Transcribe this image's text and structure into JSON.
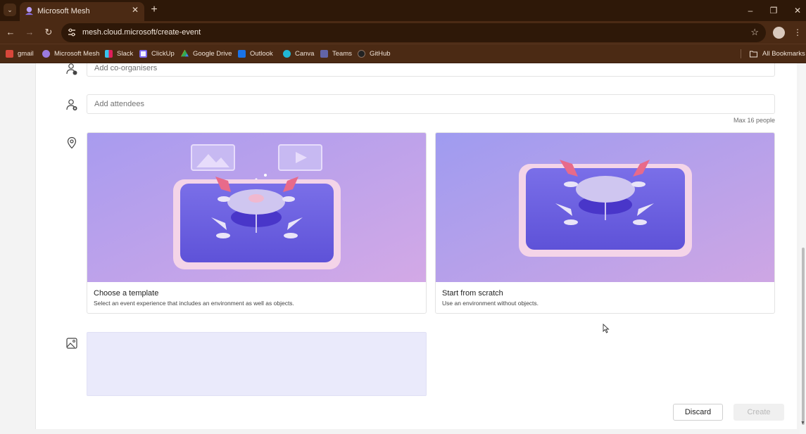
{
  "browser": {
    "tab": {
      "title": "Microsoft Mesh",
      "close_glyph": "✕"
    },
    "new_tab_glyph": "+",
    "window_controls": {
      "minimize": "–",
      "restore": "❐",
      "close": "✕"
    },
    "url": "mesh.cloud.microsoft/create-event",
    "bookmarks": [
      {
        "label": "gmail",
        "icon": "gmail-icon",
        "color": "#d8473a"
      },
      {
        "label": "Microsoft Mesh",
        "icon": "mesh-icon",
        "color": "#9b7be0"
      },
      {
        "label": "Slack",
        "icon": "slack-icon",
        "color": "#36c5f0"
      },
      {
        "label": "ClickUp",
        "icon": "clickup-icon",
        "color": "#7b68ee"
      },
      {
        "label": "Google Drive",
        "icon": "drive-icon",
        "color": "#34a853"
      },
      {
        "label": "Outlook",
        "icon": "outlook-icon",
        "color": "#1a73e8"
      },
      {
        "label": "Canva",
        "icon": "canva-icon",
        "color": "#21b8d6"
      },
      {
        "label": "Teams",
        "icon": "teams-icon",
        "color": "#6264a7"
      },
      {
        "label": "GitHub",
        "icon": "github-icon",
        "color": "#222222"
      }
    ],
    "all_bookmarks": "All Bookmarks"
  },
  "form": {
    "co_organisers_placeholder": "Add co-organisers",
    "attendees_placeholder": "Add attendees",
    "attendees_hint": "Max 16 people",
    "template_card": {
      "title": "Choose a template",
      "description": "Select an event experience that includes an environment as well as objects."
    },
    "scratch_card": {
      "title": "Start from scratch",
      "description": "Use an environment without objects."
    },
    "discard_label": "Discard",
    "create_label": "Create"
  },
  "colors": {
    "chrome_dark": "#2e1808",
    "chrome": "#4b2a14",
    "art_purple": "#6a5ee0",
    "chair_pink": "#e86a8a",
    "image_area": "#eaeafb"
  }
}
